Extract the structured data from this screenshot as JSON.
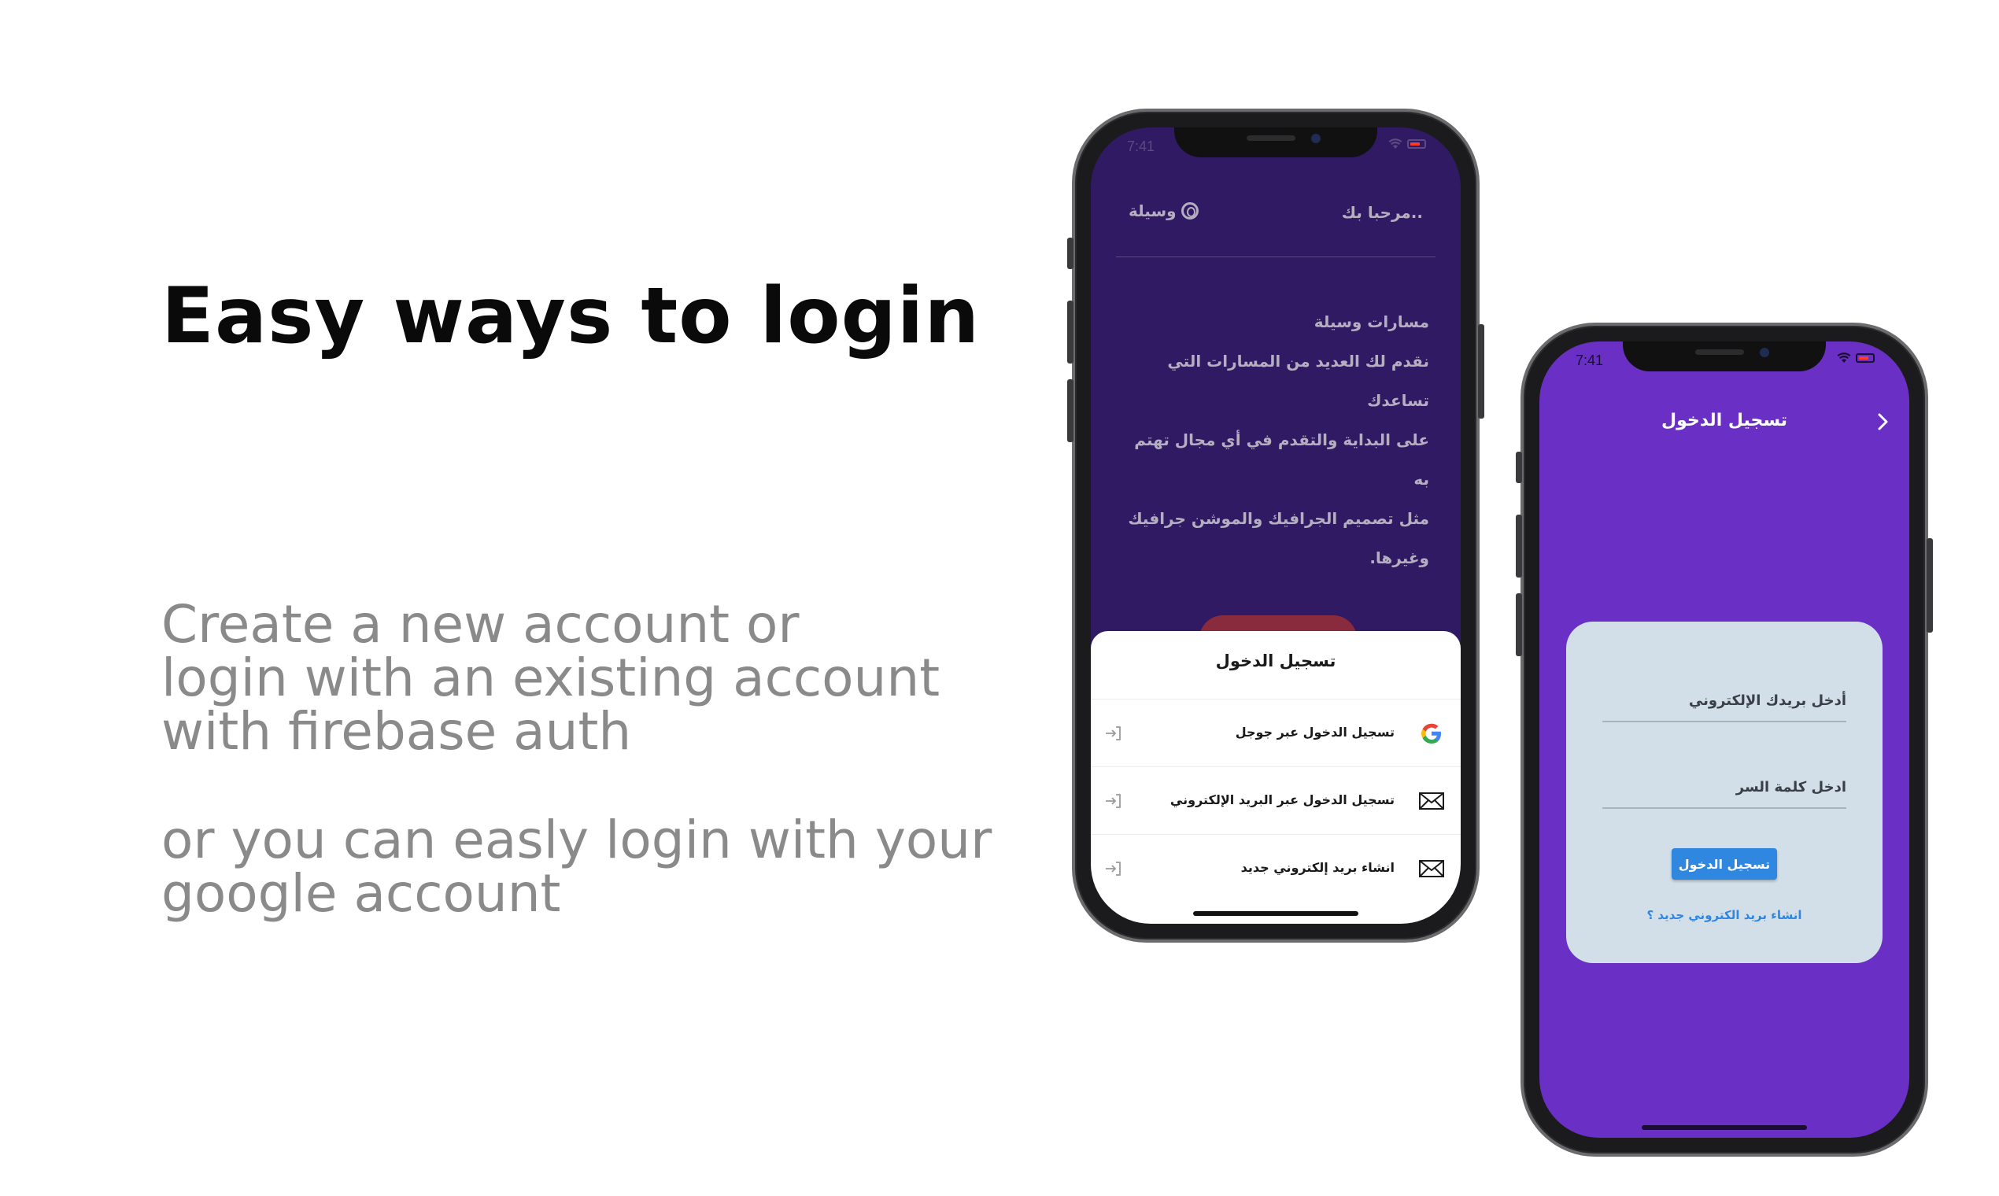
{
  "headline": "Easy ways to login",
  "copy": {
    "line1": "Create a new account or",
    "line2": "login with an existing account",
    "line3": "with firebase auth",
    "line4": "or you can easly login with your",
    "line5": "google account"
  },
  "phone1": {
    "status_time": "7:41",
    "welcome": "مرحبا بك..",
    "brand": "وسيلة",
    "body_lines": [
      "مسارات وسيلة",
      "نقدم لك العديد من المسارات التي تساعدك",
      "على البداية والتقدم في أي مجال تهتم به",
      "مثل تصميم الجرافيك والموشن جرافيك",
      "وغيرها."
    ],
    "sheet": {
      "title": "تسجيل الدخول",
      "options": [
        {
          "label": "تسجيل الدخول عبر جوجل",
          "icon": "google-icon"
        },
        {
          "label": "تسجيل الدخول عبر البريد الإلكتروني",
          "icon": "mail-icon"
        },
        {
          "label": "انشاء بريد إلكتروني جديد",
          "icon": "mail-icon"
        }
      ]
    }
  },
  "phone2": {
    "status_time": "7:41",
    "title": "تسجيل الدخول",
    "email_placeholder": "أدخل بريدك الإلكتروني",
    "password_placeholder": "ادخل كلمة السر",
    "login_button": "تسجيل الدخول",
    "signup_link": "انشاء بريد الكتروني جديد ؟"
  },
  "colors": {
    "phone1_bg": "#2f1a63",
    "phone2_bg": "#6a2fc5",
    "card_bg": "#d2dee8",
    "button_blue": "#2f87e0"
  }
}
